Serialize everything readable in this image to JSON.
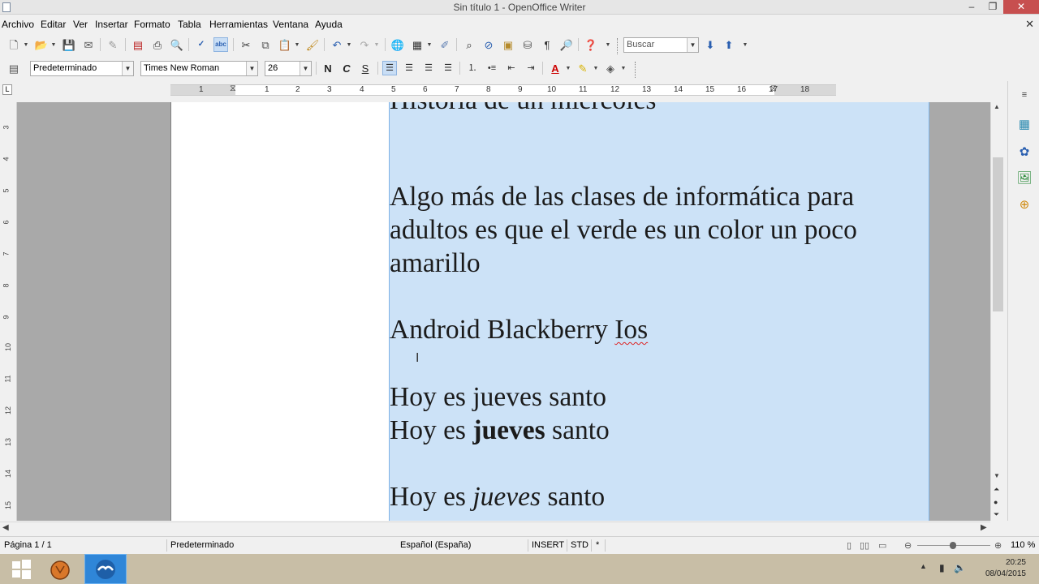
{
  "window": {
    "title": "Sin título 1 - OpenOffice Writer",
    "minimize": "–",
    "maximize": "❐",
    "close": "✕",
    "doc_close": "✕"
  },
  "menu": [
    "Archivo",
    "Editar",
    "Ver",
    "Insertar",
    "Formato",
    "Tabla",
    "Herramientas",
    "Ventana",
    "Ayuda"
  ],
  "toolbar": {
    "search_placeholder": "Buscar",
    "search_value": "Buscar",
    "paragraph_style": "Predeterminado",
    "font_name": "Times New Roman",
    "font_size": "26",
    "bold": "N",
    "italic": "C",
    "underline": "S"
  },
  "ruler": {
    "corner": "L",
    "numbers": [
      "1",
      "1",
      "2",
      "3",
      "4",
      "5",
      "6",
      "7",
      "8",
      "9",
      "10",
      "11",
      "12",
      "13",
      "14",
      "15",
      "16",
      "17",
      "18"
    ]
  },
  "vruler": [
    "3",
    "4",
    "5",
    "6",
    "7",
    "8",
    "9",
    "10",
    "11",
    "12",
    "13",
    "14",
    "15"
  ],
  "document": {
    "line_top_partial": "Historia de un miércoles",
    "para1_line1": "Algo más de las clases de informática para",
    "para1_line2": "adultos es que el verde es un color un poco",
    "para1_line3": "amarillo",
    "para2_a": "Android Blackberry ",
    "para2_b": "Ios",
    "line_plain": " Hoy es jueves santo",
    "bold_a": "Hoy es ",
    "bold_b": "jueves",
    "bold_c": " santo",
    "italic_a": "Hoy es ",
    "italic_b": "jueves",
    "italic_c": " santo"
  },
  "status": {
    "page": "Página  1 / 1",
    "style": "Predeterminado",
    "language": "Español (España)",
    "insert": "INSERT",
    "std": "STD",
    "modified": "*",
    "zoom": "110 %"
  },
  "taskbar": {
    "time": "20:25",
    "date": "08/04/2015"
  },
  "colors": {
    "selection": "#cce2f7",
    "selection_border": "#7fb3e6",
    "close_button": "#c74f4f",
    "page_bg": "#a9a9a9"
  }
}
